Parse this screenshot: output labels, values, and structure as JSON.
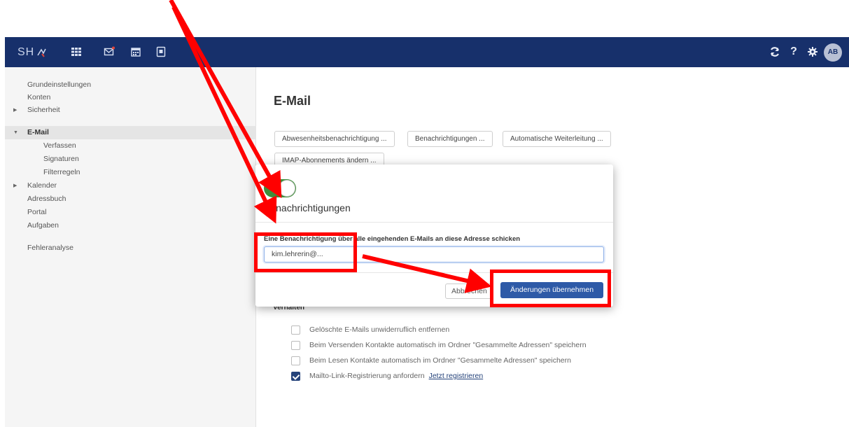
{
  "topbar": {
    "brand": "SH",
    "icons": [
      "apps-grid-icon",
      "mail-icon",
      "calendar-icon",
      "contacts-icon"
    ],
    "right_icons": [
      "refresh-icon",
      "help-icon",
      "settings-icon"
    ],
    "avatar": "AB",
    "background": "#17306b"
  },
  "sidebar": {
    "items": [
      {
        "label": "Grundeinstellungen",
        "level": 0,
        "expandable": false
      },
      {
        "label": "Konten",
        "level": 0,
        "expandable": false
      },
      {
        "label": "Sicherheit",
        "level": 0,
        "expandable": true
      },
      {
        "label": "E-Mail",
        "level": 0,
        "expandable": true,
        "active": true
      },
      {
        "label": "Verfassen",
        "level": 1
      },
      {
        "label": "Signaturen",
        "level": 1
      },
      {
        "label": "Filterregeln",
        "level": 1
      },
      {
        "label": "Kalender",
        "level": 0,
        "expandable": true
      },
      {
        "label": "Adressbuch",
        "level": 0
      },
      {
        "label": "Portal",
        "level": 0
      },
      {
        "label": "Aufgaben",
        "level": 0
      },
      {
        "label": "Fehleranalyse",
        "level": 0
      }
    ]
  },
  "main": {
    "title": "E-Mail",
    "buttons": [
      "Abwesenheitsbenachrichtigung ...",
      "Benachrichtigungen ...",
      "Automatische Weiterleitung ...",
      "IMAP-Abonnements ändern ..."
    ],
    "section": "Verhalten",
    "options": [
      {
        "label": "Gelöschte E-Mails unwiderruflich entfernen",
        "checked": false
      },
      {
        "label": "Beim Versenden Kontakte automatisch im Ordner \"Gesammelte Adressen\" speichern",
        "checked": false
      },
      {
        "label": "Beim Lesen Kontakte automatisch im Ordner \"Gesammelte Adressen\" speichern",
        "checked": false
      },
      {
        "label": "Mailto-Link-Registrierung anfordern",
        "checked": true,
        "link": "Jetzt registrieren"
      }
    ]
  },
  "modal": {
    "toggle_on": true,
    "title": "Benachrichtigungen",
    "field_label": "Eine Benachrichtigung über alle eingehenden E-Mails an diese Adresse schicken",
    "field_value": "kim.lehrerin@...",
    "cancel": "Abbrechen",
    "apply": "Änderungen übernehmen",
    "apply_color": "#2e5aa7",
    "toggle_color": "#3e8e3a"
  },
  "annotation": {
    "color": "#ff0000"
  }
}
